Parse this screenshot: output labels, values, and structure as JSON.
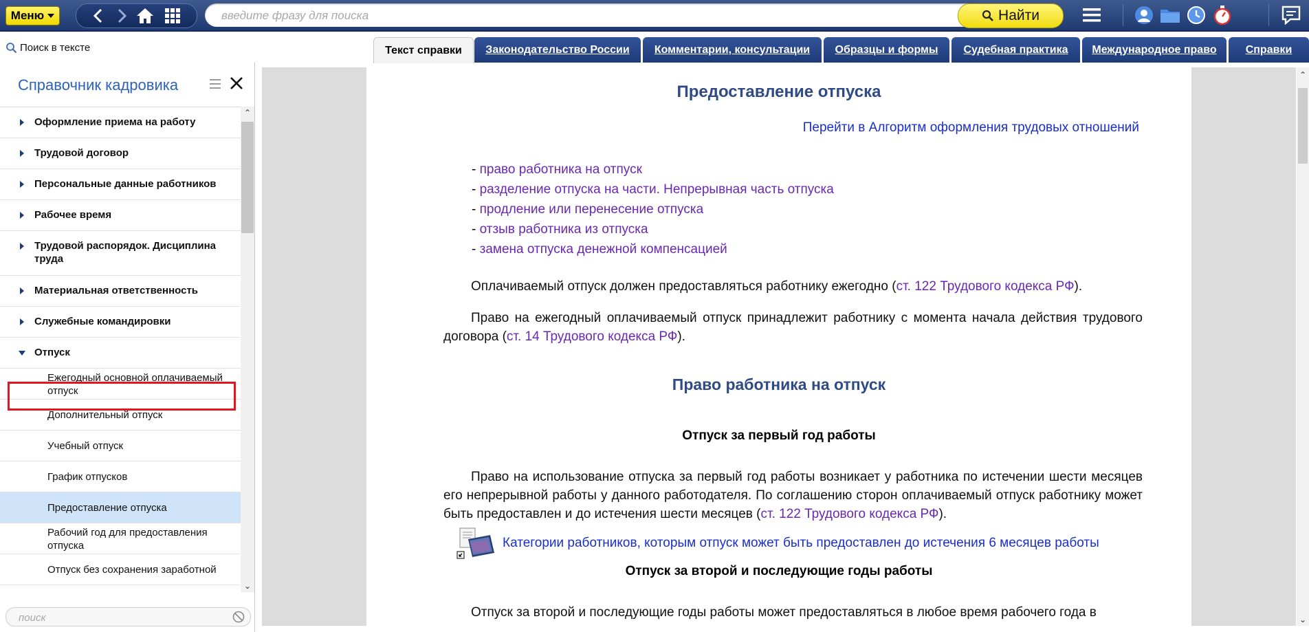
{
  "topbar": {
    "menu_label": "Меню",
    "search_placeholder": "введите фразу для поиска",
    "search_value": "",
    "find_label": "Найти",
    "icons": [
      "back-icon",
      "forward-icon",
      "home-icon",
      "grid-icon",
      "hamburger-icon",
      "profile-icon",
      "folder-icon",
      "history-clock-icon",
      "stopwatch-icon",
      "chat-icon"
    ]
  },
  "search_in_text": {
    "label": "Поиск в тексте"
  },
  "tabs": [
    {
      "label": "Текст справки",
      "active": true
    },
    {
      "label": "Законодательство России"
    },
    {
      "label": "Комментарии, консультации"
    },
    {
      "label": "Образцы и формы"
    },
    {
      "label": "Судебная практика"
    },
    {
      "label": "Международное право"
    },
    {
      "label": "Справки"
    }
  ],
  "sidebar": {
    "title": "Справочник кадровика",
    "items": [
      {
        "label": "Оформление приема на работу"
      },
      {
        "label": "Трудовой договор"
      },
      {
        "label": "Персональные данные работников"
      },
      {
        "label": "Рабочее время"
      },
      {
        "label": "Трудовой распорядок. Дисциплина труда"
      },
      {
        "label": "Материальная ответственность"
      },
      {
        "label": "Служебные командировки"
      },
      {
        "label": "Отпуск",
        "expanded": true
      }
    ],
    "subitems": [
      {
        "label": "Ежегодный основной оплачиваемый отпуск"
      },
      {
        "label": "Дополнительный отпуск"
      },
      {
        "label": "Учебный отпуск"
      },
      {
        "label": "График отпусков"
      },
      {
        "label": "Предоставление отпуска",
        "selected": true
      },
      {
        "label": "Рабочий год для предоставления отпуска"
      },
      {
        "label": "Отпуск без сохранения заработной"
      }
    ],
    "search_placeholder": "поиск"
  },
  "document": {
    "title": "Предоставление отпуска",
    "goto_link": "Перейти в Алгоритм оформления трудовых отношений",
    "toc_prefix": "- ",
    "toc": [
      "право работника на отпуск",
      "разделение отпуска на части. Непрерывная часть отпуска",
      "продление или перенесение отпуска",
      "отзыв работника из отпуска",
      "замена отпуска денежной компенсацией"
    ],
    "p1": {
      "before": "Оплачиваемый отпуск должен предоставляться работнику ежегодно (",
      "link": "ст. 122 Трудового кодекса РФ",
      "after": ")."
    },
    "p2": {
      "before": "Право на ежегодный оплачиваемый отпуск принадлежит работнику с момента начала действия трудового договора (",
      "link": "ст. 14 Трудового кодекса РФ",
      "after": ")."
    },
    "section_title": "Право работника на отпуск",
    "sub1": "Отпуск за первый год работы",
    "p3": {
      "before": "Право на использование отпуска за первый год работы возникает у работника по истечении шести месяцев его непрерывной работы у данного работодателя. По соглашению сторон оплачиваемый отпуск работнику может быть предоставлен и до истечения шести месяцев (",
      "link": "ст. 122 Трудового кодекса РФ",
      "after": ")."
    },
    "category_link": "Категории работников, которым отпуск может быть предоставлен до истечения 6 месяцев работы",
    "sub2": "Отпуск за второй и последующие годы работы",
    "p4": "Отпуск за второй и последующие годы работы может предоставляться в любое время рабочего года в"
  },
  "colors": {
    "topbar": "#1f3a70",
    "accent_yellow": "#f2dc10",
    "title_blue": "#2f4a85",
    "link_purple": "#6a28b0",
    "link_blue": "#1a2ecc",
    "highlight_red": "#e2161c",
    "selected_bg": "#cfe3f9"
  }
}
